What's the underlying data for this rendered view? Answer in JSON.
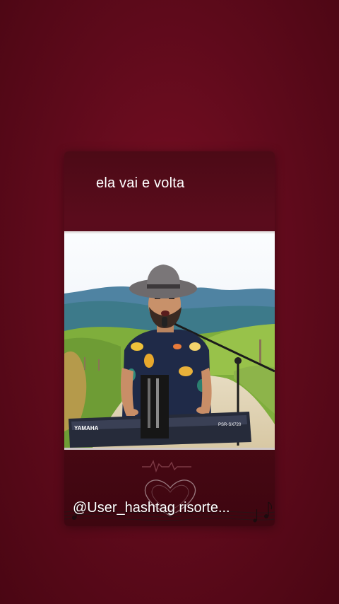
{
  "caption_top": "ela vai e volta",
  "caption_bottom": "@User_hashtag risorte...",
  "photo": {
    "keyboard_brand": "YAMAHA",
    "keyboard_model": "PSR-SX720"
  },
  "colors": {
    "background": "#5e0a1b",
    "card": "#4c0a16",
    "text": "#ffffff"
  }
}
